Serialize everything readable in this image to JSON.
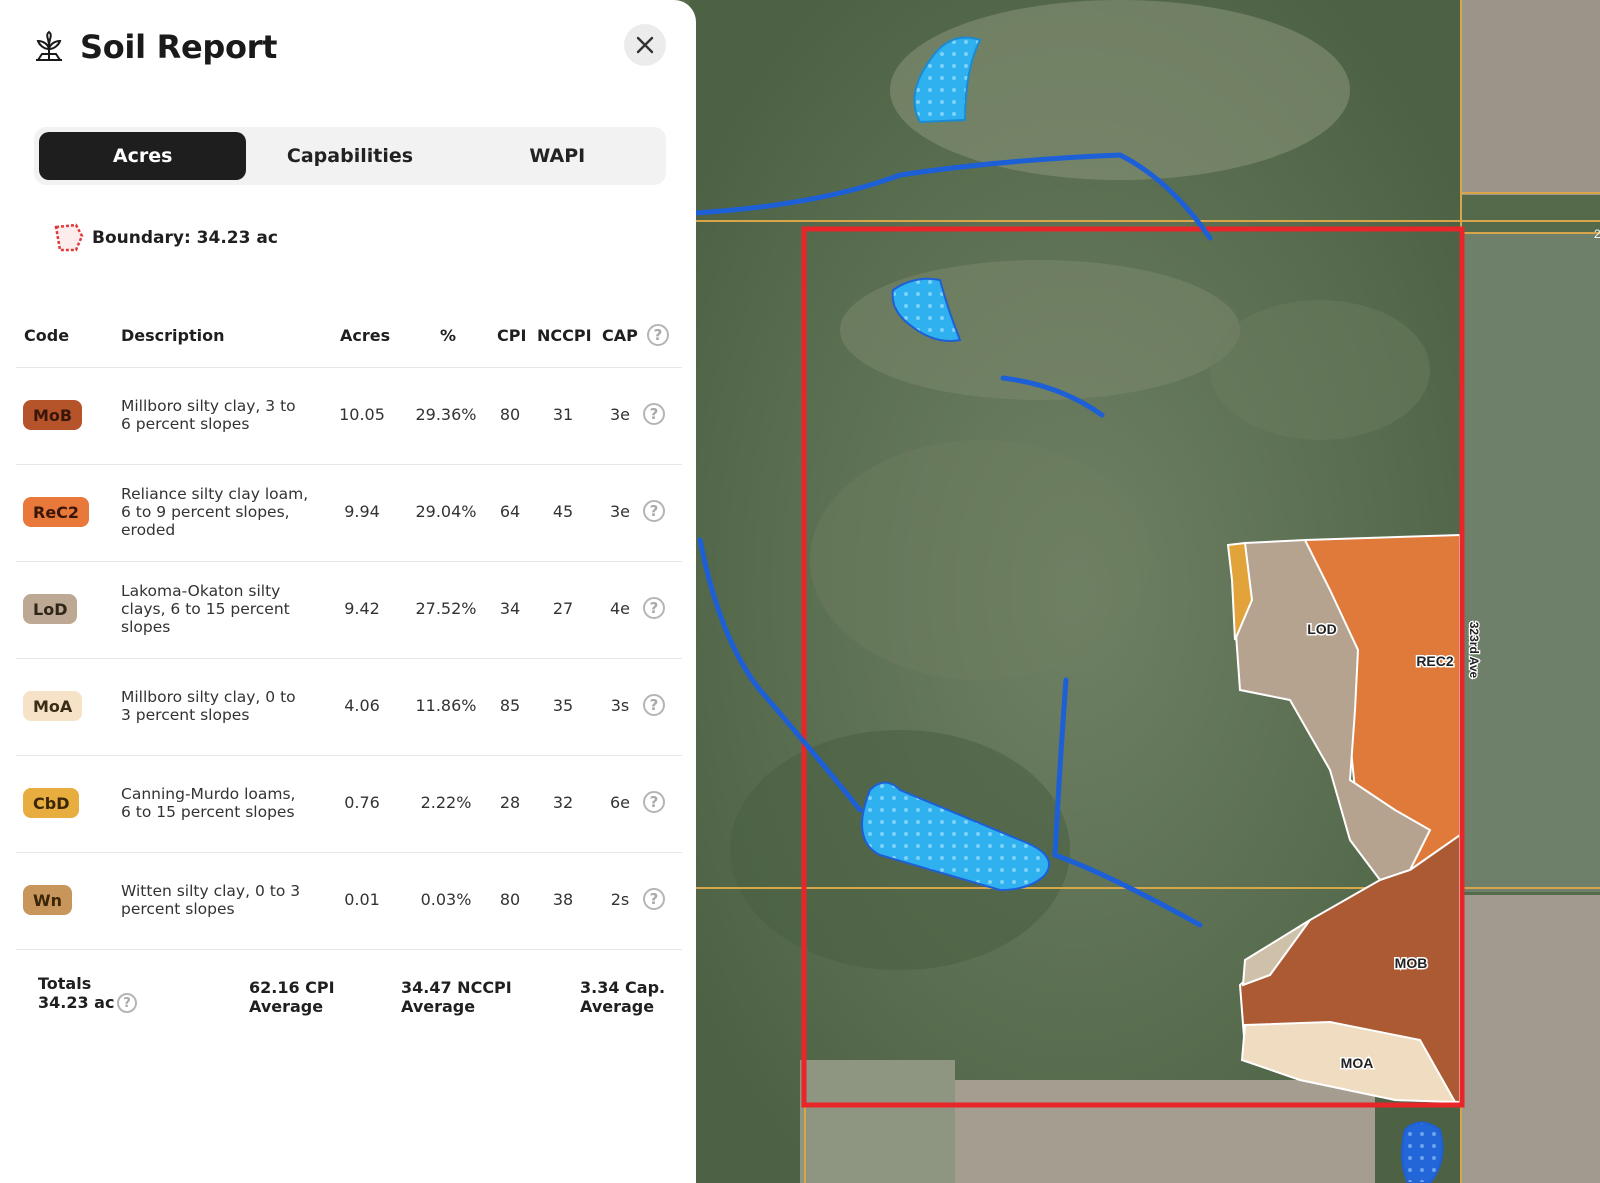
{
  "header": {
    "title": "Soil Report",
    "logo_icon": "plant-seedling-icon",
    "close_icon": "close-icon"
  },
  "tabs": [
    {
      "label": "Acres",
      "active": true
    },
    {
      "label": "Capabilities",
      "active": false
    },
    {
      "label": "WAPI",
      "active": false
    }
  ],
  "boundary": {
    "label": "Boundary: 34.23 ac",
    "icon": "boundary-polygon-icon"
  },
  "table": {
    "columns": [
      "Code",
      "Description",
      "Acres",
      "%",
      "CPI",
      "NCCPI",
      "CAP"
    ],
    "help_glyph": "?",
    "rows": [
      {
        "code": "MoB",
        "color": "#b5542b",
        "text_color": "#3a1608",
        "description": [
          "Millboro silty clay, 3 to",
          "6 percent slopes"
        ],
        "acres": "10.05",
        "pct": "29.36%",
        "cpi": "80",
        "nccpi": "31",
        "cap": "3e"
      },
      {
        "code": "ReC2",
        "color": "#e8793b",
        "text_color": "#3a1608",
        "description": [
          "Reliance silty clay loam,",
          "6 to 9 percent slopes,",
          "eroded"
        ],
        "acres": "9.94",
        "pct": "29.04%",
        "cpi": "64",
        "nccpi": "45",
        "cap": "3e"
      },
      {
        "code": "LoD",
        "color": "#bda894",
        "text_color": "#2e2519",
        "description": [
          "Lakoma-Okaton silty",
          "clays, 6 to 15 percent",
          "slopes"
        ],
        "acres": "9.42",
        "pct": "27.52%",
        "cpi": "34",
        "nccpi": "27",
        "cap": "4e"
      },
      {
        "code": "MoA",
        "color": "#f6e2c7",
        "text_color": "#3b2c18",
        "description": [
          "Millboro silty clay, 0 to",
          "3 percent slopes"
        ],
        "acres": "4.06",
        "pct": "11.86%",
        "cpi": "85",
        "nccpi": "35",
        "cap": "3s"
      },
      {
        "code": "CbD",
        "color": "#e8ad3f",
        "text_color": "#3b2608",
        "description": [
          "Canning-Murdo loams,",
          "6 to 15 percent slopes"
        ],
        "acres": "0.76",
        "pct": "2.22%",
        "cpi": "28",
        "nccpi": "32",
        "cap": "6e"
      },
      {
        "code": "Wn",
        "color": "#c8955a",
        "text_color": "#3b2608",
        "description": [
          "Witten silty clay, 0 to 3",
          "percent slopes"
        ],
        "acres": "0.01",
        "pct": "0.03%",
        "cpi": "80",
        "nccpi": "38",
        "cap": "2s"
      }
    ]
  },
  "totals": {
    "label": "Totals",
    "acres": "34.23 ac",
    "cpi_avg": [
      "62.16 CPI",
      "Average"
    ],
    "nccpi_avg": [
      "34.47 NCCPI",
      "Average"
    ],
    "cap_avg": [
      "3.34 Cap.",
      "Average"
    ]
  },
  "map": {
    "soil_labels": [
      "LOD",
      "REC2",
      "MOB",
      "MOA"
    ],
    "road_label": "323rd Ave",
    "edge_label": "2",
    "colors": {
      "boundary": "#e8262a",
      "water": "#34b7f0",
      "stream": "#1d5fd6"
    }
  }
}
